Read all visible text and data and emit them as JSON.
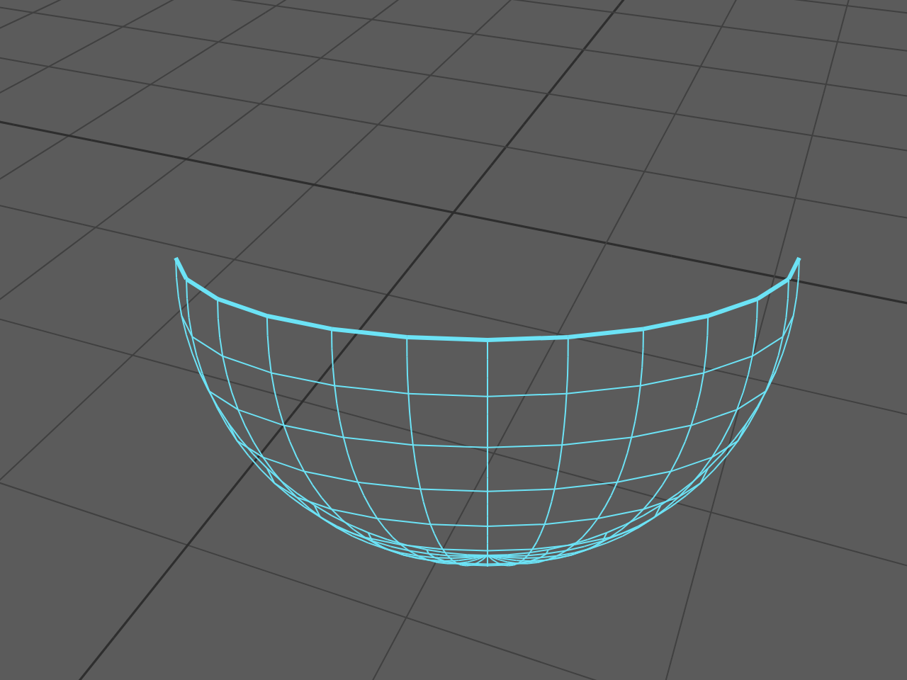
{
  "viewport": {
    "show_grid": true,
    "objects": [
      {
        "kind": "wireframe-bowl",
        "selected": true
      }
    ]
  }
}
